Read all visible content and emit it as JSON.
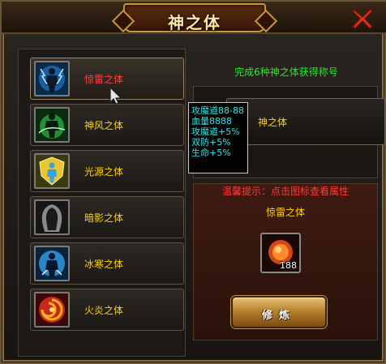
{
  "window": {
    "title": "神之体",
    "close_icon": "close-x-icon"
  },
  "body_list": [
    {
      "label": "惊雷之体",
      "icon": "thunder-figure-icon",
      "selected": true
    },
    {
      "label": "神风之体",
      "icon": "wind-figure-icon",
      "selected": false
    },
    {
      "label": "光源之体",
      "icon": "light-shield-icon",
      "selected": false
    },
    {
      "label": "暗影之体",
      "icon": "shadow-figure-icon",
      "selected": false
    },
    {
      "label": "冰寒之体",
      "icon": "ice-figure-icon",
      "selected": false
    },
    {
      "label": "火炎之体",
      "icon": "fire-swirl-icon",
      "selected": false
    }
  ],
  "reward": {
    "info": "完成6种神之体获得称号",
    "title_name": "神之体"
  },
  "tooltip": {
    "lines": [
      "攻魔道88-88",
      "血量8888",
      "攻魔道+5%",
      "双防+5%",
      "生命+5%"
    ]
  },
  "detail": {
    "hint": "温馨提示：点击图标查看属性",
    "selected_name": "惊雷之体",
    "item_count": "188",
    "train_label": "修炼"
  },
  "colors": {
    "selected_text": "#ff4040",
    "item_text": "#ffd200",
    "info_text": "#2ee62e",
    "tooltip_text": "#33e6e6",
    "hint_text": "#ff3a3a"
  }
}
